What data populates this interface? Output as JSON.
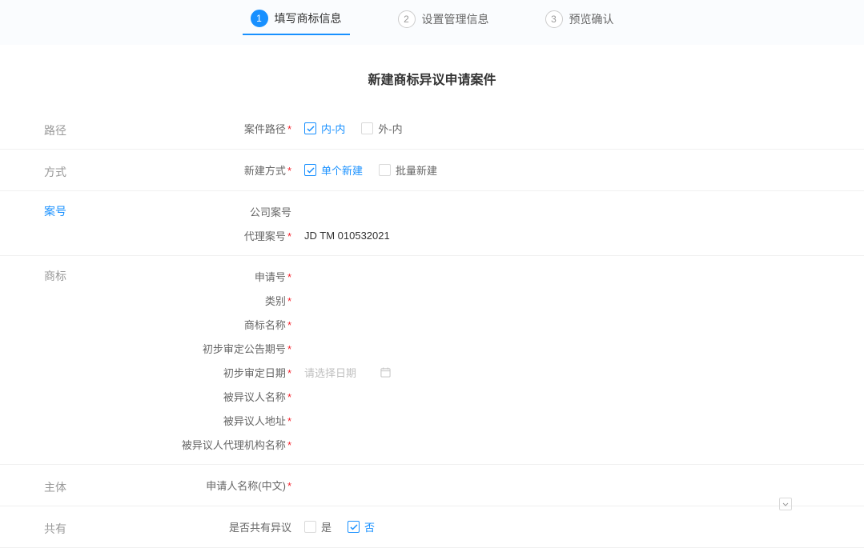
{
  "steps": [
    {
      "num": "1",
      "label": "填写商标信息",
      "active": true
    },
    {
      "num": "2",
      "label": "设置管理信息",
      "active": false
    },
    {
      "num": "3",
      "label": "预览确认",
      "active": false
    }
  ],
  "pageTitle": "新建商标异议申请案件",
  "sections": {
    "path": {
      "sectionLabel": "路径",
      "field": {
        "label": "案件路径",
        "required": true,
        "options": [
          {
            "label": "内-内",
            "checked": true
          },
          {
            "label": "外-内",
            "checked": false
          }
        ]
      }
    },
    "method": {
      "sectionLabel": "方式",
      "field": {
        "label": "新建方式",
        "required": true,
        "options": [
          {
            "label": "单个新建",
            "checked": true
          },
          {
            "label": "批量新建",
            "checked": false
          }
        ]
      }
    },
    "caseNo": {
      "sectionLabel": "案号",
      "fields": [
        {
          "label": "公司案号",
          "required": false,
          "value": "",
          "highlight": true
        },
        {
          "label": "代理案号",
          "required": true,
          "value": "JD TM 010532021",
          "highlight": false
        }
      ]
    },
    "trademark": {
      "sectionLabel": "商标",
      "fields": [
        {
          "label": "申请号",
          "required": true,
          "type": "text"
        },
        {
          "label": "类别",
          "required": true,
          "type": "text"
        },
        {
          "label": "商标名称",
          "required": true,
          "type": "text"
        },
        {
          "label": "初步审定公告期号",
          "required": true,
          "type": "text"
        },
        {
          "label": "初步审定日期",
          "required": true,
          "type": "date",
          "placeholder": "请选择日期"
        },
        {
          "label": "被异议人名称",
          "required": true,
          "type": "text"
        },
        {
          "label": "被异议人地址",
          "required": true,
          "type": "text"
        },
        {
          "label": "被异议人代理机构名称",
          "required": true,
          "type": "text"
        }
      ]
    },
    "subject": {
      "sectionLabel": "主体",
      "field": {
        "label": "申请人名称(中文)",
        "required": true,
        "type": "select"
      }
    },
    "shared": {
      "sectionLabel": "共有",
      "field": {
        "label": "是否共有异议",
        "required": false,
        "options": [
          {
            "label": "是",
            "checked": false
          },
          {
            "label": "否",
            "checked": true
          }
        ]
      }
    }
  }
}
